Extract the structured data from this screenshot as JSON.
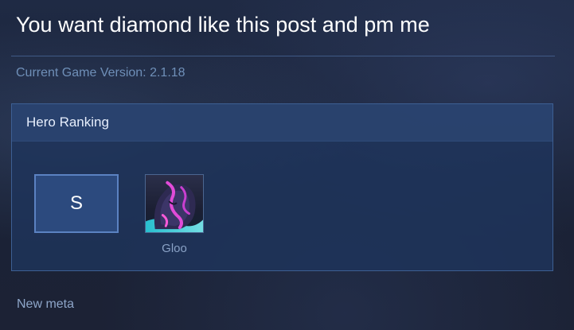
{
  "post": {
    "title": "You want diamond like this post and pm me",
    "version_text": "Current Game Version: 2.1.18"
  },
  "ranking": {
    "title": "Hero Ranking",
    "tier": "S",
    "heroes": [
      {
        "name": "Gloo",
        "icon": "gloo-hero-portrait"
      }
    ]
  },
  "footer": {
    "text": "New meta"
  },
  "colors": {
    "background": "#1b2236",
    "panel": "#1e345c",
    "panel_border": "#3d5f93",
    "tier_border": "#5b82c2",
    "muted_text": "#6f8fb8"
  }
}
